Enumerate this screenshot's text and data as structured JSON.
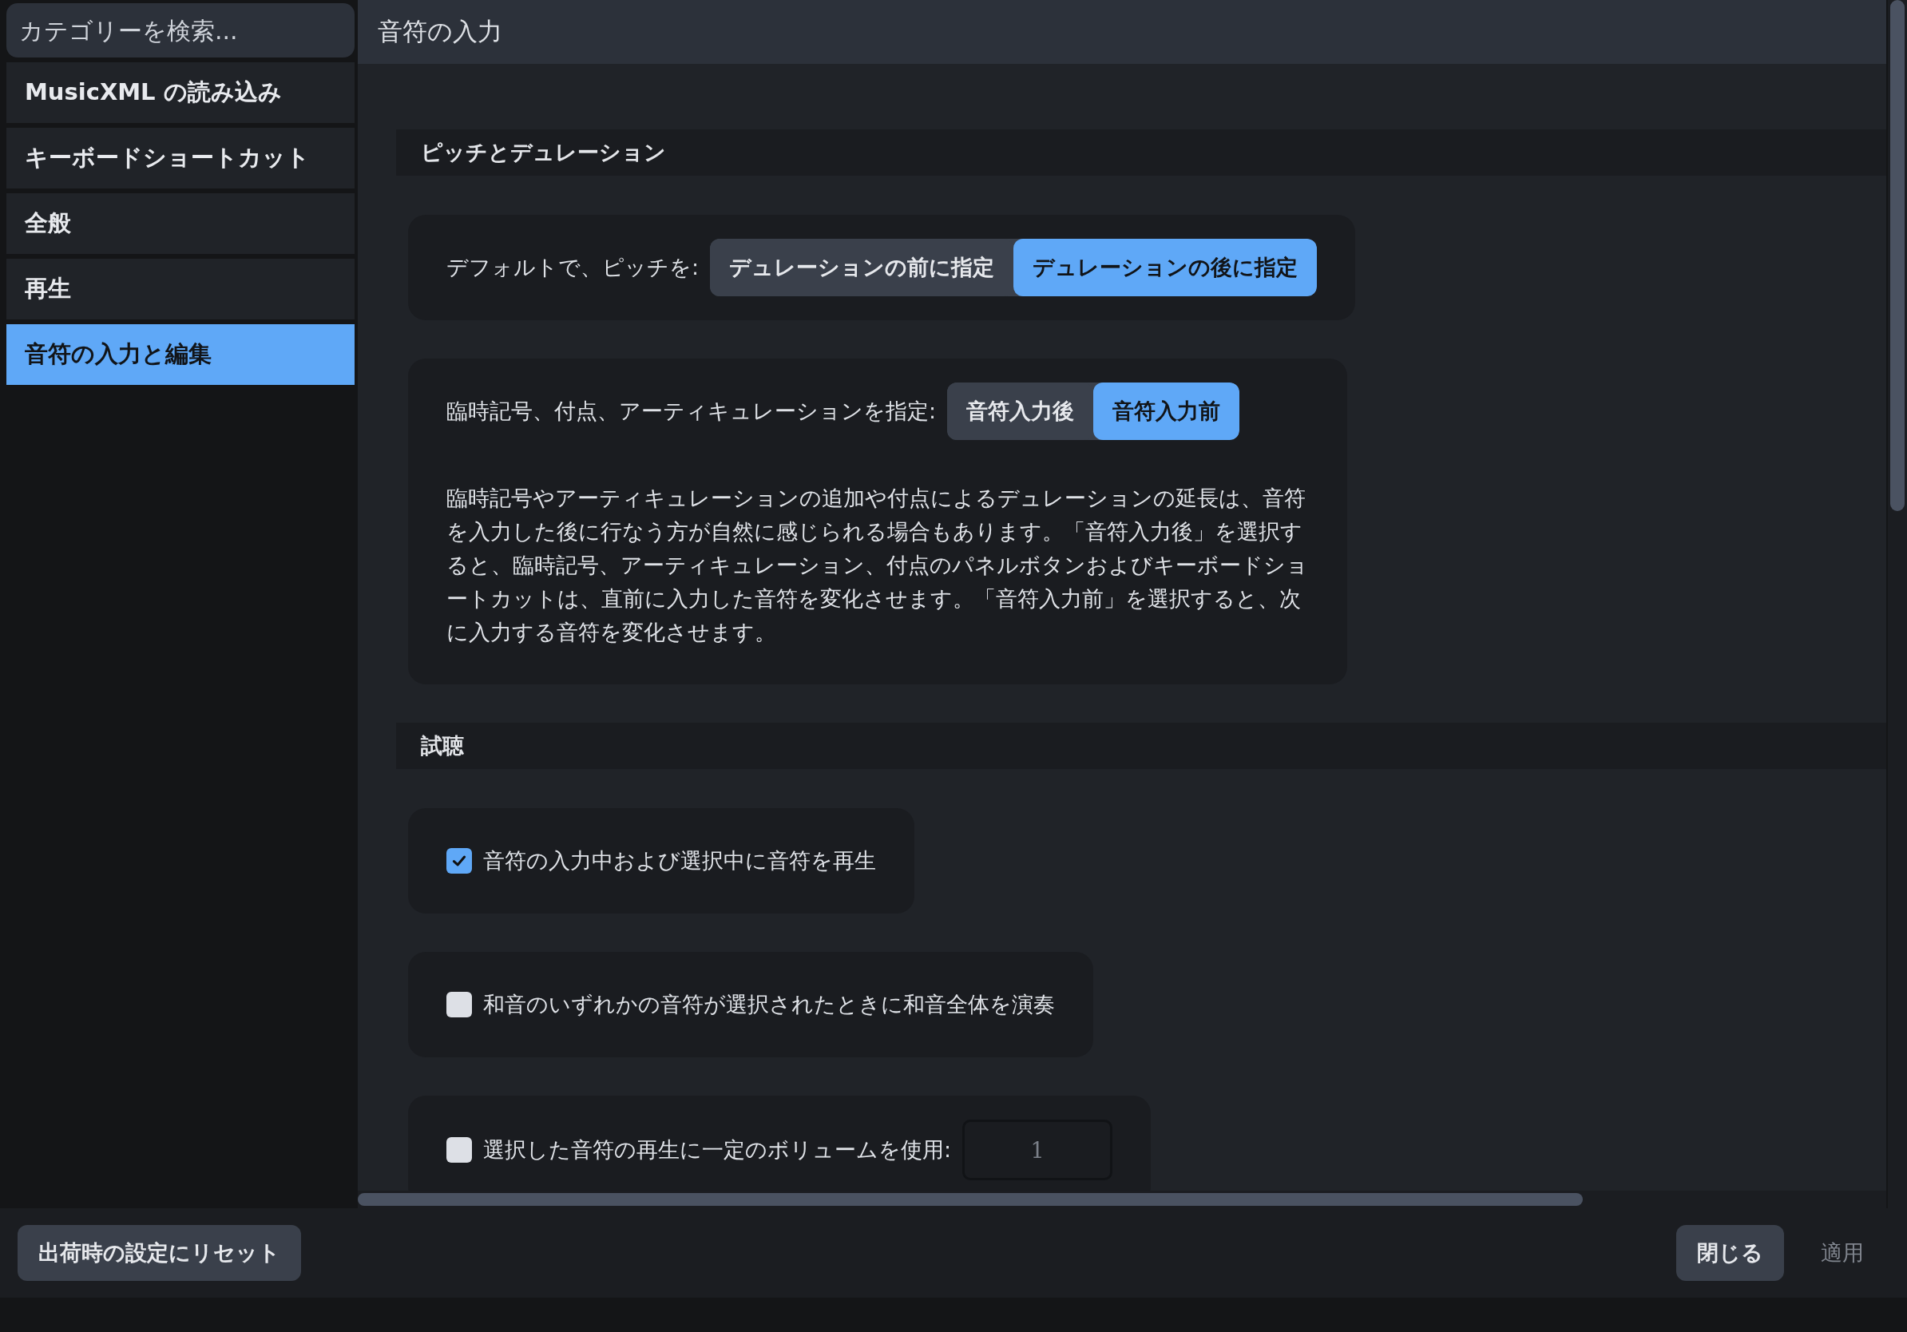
{
  "sidebar": {
    "search": {
      "placeholder": "カテゴリーを検索..."
    },
    "items": [
      {
        "label": "MusicXML の読み込み",
        "selected": false
      },
      {
        "label": "キーボードショートカット",
        "selected": false
      },
      {
        "label": "全般",
        "selected": false
      },
      {
        "label": "再生",
        "selected": false
      },
      {
        "label": "音符の入力と編集",
        "selected": true
      }
    ]
  },
  "page": {
    "title": "音符の入力",
    "sections": [
      {
        "title": "ピッチとデュレーション",
        "cards": [
          {
            "kind": "segmented",
            "label": "デフォルトで、ピッチを:",
            "options": [
              {
                "label": "デュレーションの前に指定",
                "selected": false
              },
              {
                "label": "デュレーションの後に指定",
                "selected": true
              }
            ]
          },
          {
            "kind": "segmented",
            "label": "臨時記号、付点、アーティキュレーションを指定:",
            "options": [
              {
                "label": "音符入力後",
                "selected": false
              },
              {
                "label": "音符入力前",
                "selected": true
              }
            ],
            "description": "臨時記号やアーティキュレーションの追加や付点によるデュレーションの延長は、音符を入力した後に行なう方が自然に感じられる場合もあります。「音符入力後」を選択すると、臨時記号、アーティキュレーション、付点のパネルボタンおよびキーボードショートカットは、直前に入力した音符を変化させます。「音符入力前」を選択すると、次に入力する音符を変化させます。"
          }
        ]
      },
      {
        "title": "試聴",
        "cards": [
          {
            "kind": "checkbox",
            "label": "音符の入力中および選択中に音符を再生",
            "checked": true
          },
          {
            "kind": "checkbox",
            "label": "和音のいずれかの音符が選択されたときに和音全体を演奏",
            "checked": false
          },
          {
            "kind": "checkbox",
            "label": "選択した音符の再生に一定のボリュームを使用:",
            "checked": false,
            "field": {
              "value": "1",
              "disabled": true
            }
          }
        ]
      }
    ]
  },
  "footer": {
    "reset_button": {
      "label": "出荷時の設定にリセット"
    },
    "buttons": [
      {
        "label": "閉じる",
        "disabled": false
      },
      {
        "label": "適用",
        "disabled": true
      }
    ]
  }
}
